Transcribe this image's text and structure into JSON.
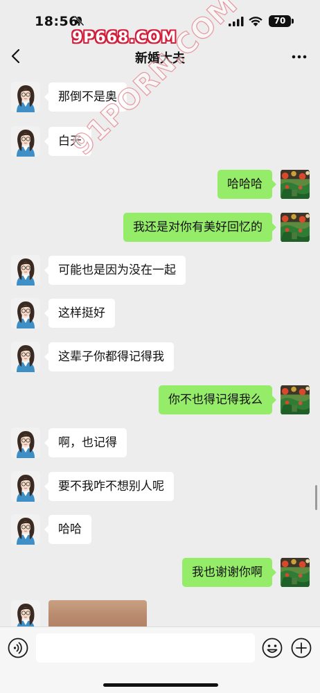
{
  "status_bar": {
    "time": "18:56",
    "battery": "70"
  },
  "watermarks": {
    "top": "9P668.COM",
    "diagonal": "91PORN.COM"
  },
  "nav": {
    "title": "新婚大夫"
  },
  "messages": [
    {
      "side": "left",
      "text": "那倒不是奥"
    },
    {
      "side": "left",
      "text": "白天"
    },
    {
      "side": "right",
      "text": "哈哈哈"
    },
    {
      "side": "right",
      "text": "我还是对你有美好回忆的"
    },
    {
      "side": "left",
      "text": "可能也是因为没在一起"
    },
    {
      "side": "left",
      "text": "这样挺好"
    },
    {
      "side": "left",
      "text": "这辈子你都得记得我"
    },
    {
      "side": "right",
      "text": "你不也得记得我么"
    },
    {
      "side": "left",
      "text": "啊，也记得"
    },
    {
      "side": "left",
      "text": "要不我咋不想别人呢"
    },
    {
      "side": "left",
      "text": "哈哈"
    },
    {
      "side": "right",
      "text": "我也谢谢你啊"
    },
    {
      "side": "left",
      "type": "image"
    }
  ],
  "input": {
    "placeholder": ""
  },
  "icons": {
    "back": "chevron-left-icon",
    "more": "more-dots-icon",
    "voice": "voice-icon",
    "emoji": "emoji-icon",
    "plus": "plus-icon",
    "mute": "bell-off-icon"
  }
}
